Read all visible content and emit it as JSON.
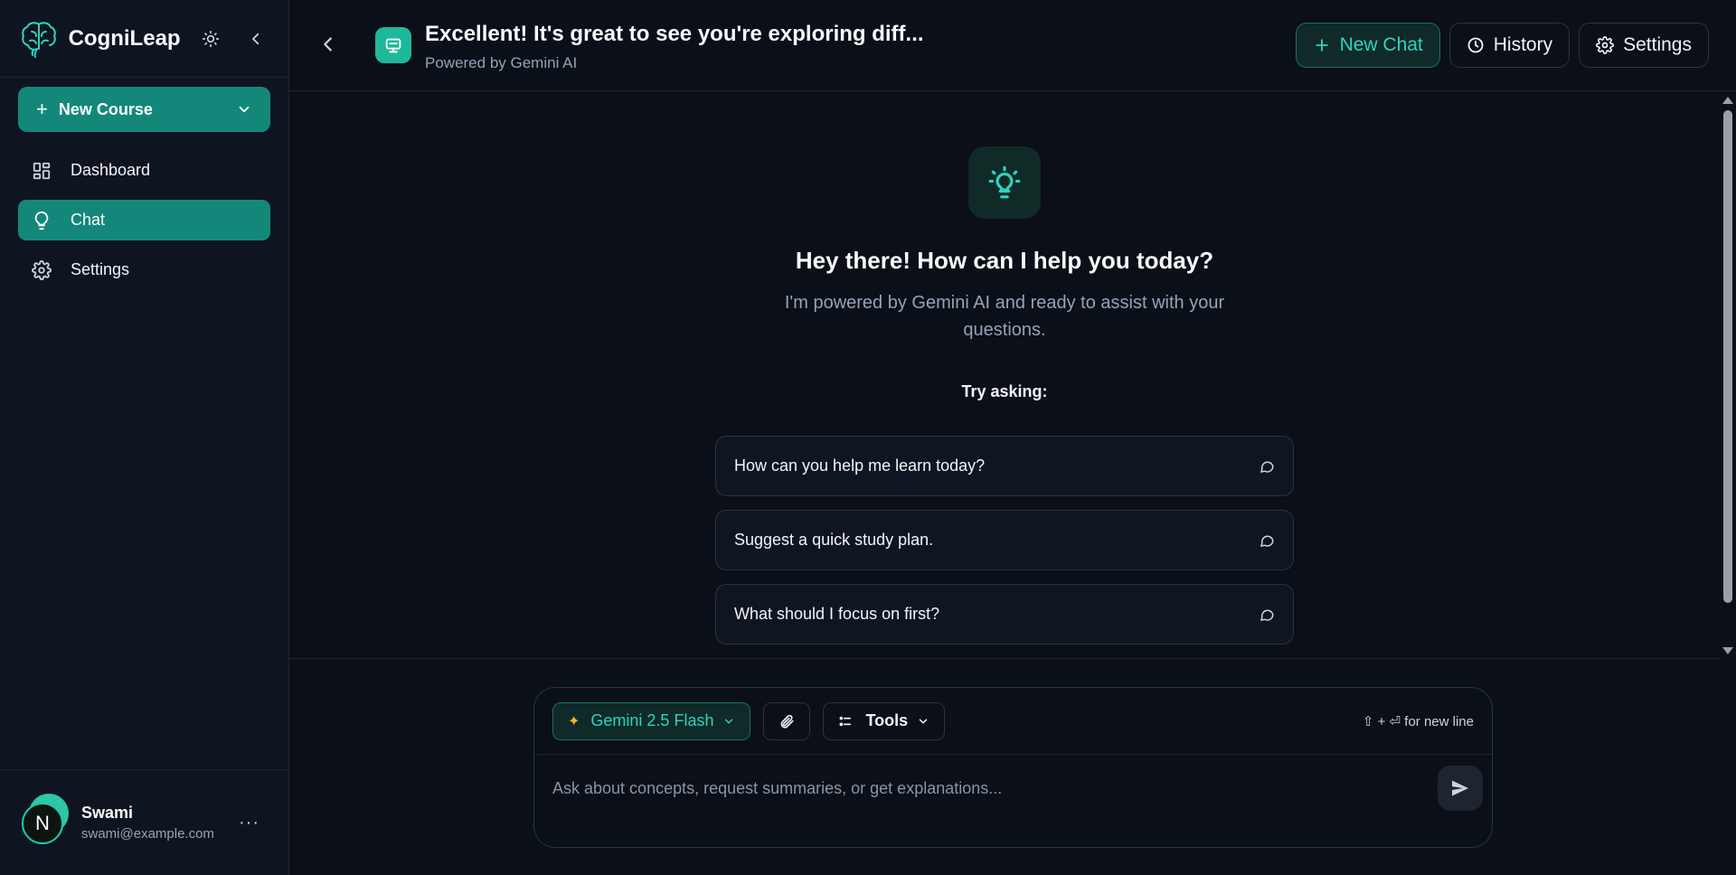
{
  "app": {
    "name": "CogniLeap"
  },
  "sidebar": {
    "new_course_label": "New Course",
    "items": [
      {
        "label": "Dashboard",
        "icon": "dashboard-icon",
        "active": false
      },
      {
        "label": "Chat",
        "icon": "lightbulb-icon",
        "active": true
      },
      {
        "label": "Settings",
        "icon": "gear-icon",
        "active": false
      }
    ],
    "user": {
      "initial": "N",
      "name": "Swami",
      "email": "swami@example.com",
      "more": "···"
    }
  },
  "header": {
    "title": "Excellent! It's great to see you're exploring diff...",
    "subtitle": "Powered by Gemini AI",
    "new_chat_label": "New Chat",
    "history_label": "History",
    "settings_label": "Settings"
  },
  "welcome": {
    "title": "Hey there! How can I help you today?",
    "subtitle": "I'm powered by Gemini AI and ready to assist with your questions.",
    "try_label": "Try asking:",
    "suggestions": [
      "How can you help me learn today?",
      "Suggest a quick study plan.",
      "What should I focus on first?"
    ]
  },
  "composer": {
    "model_label": "Gemini 2.5 Flash",
    "tools_label": "Tools",
    "hint": "⇧ + ⏎ for new line",
    "placeholder": "Ask about concepts, request summaries, or get explanations..."
  },
  "colors": {
    "accent": "#13887a",
    "accent_text": "#2dd4bf",
    "background": "#0b0f17",
    "sidebar": "#0f1520"
  }
}
